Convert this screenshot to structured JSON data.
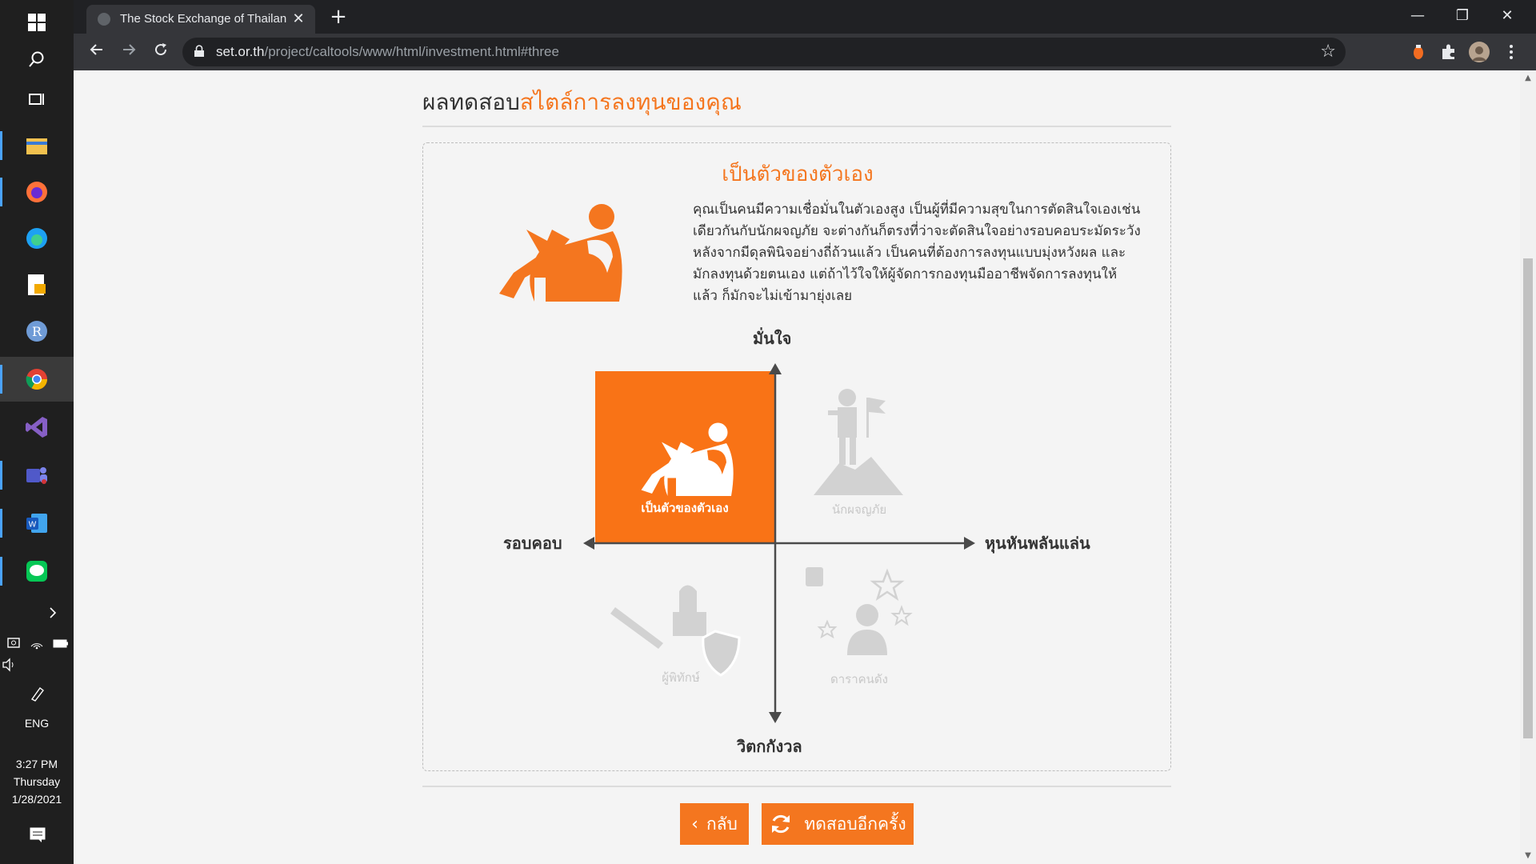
{
  "taskbar": {
    "time": "3:27 PM",
    "day": "Thursday",
    "date": "1/28/2021",
    "language": "ENG"
  },
  "browser": {
    "tab_title": "The Stock Exchange of Thailand :",
    "url_host": "set.or.th",
    "url_path": "/project/caltools/www/html/investment.html#three"
  },
  "page": {
    "heading_prefix": "ผลทดสอบ",
    "heading_accent": "สไตล์การลงทุนของคุณ",
    "result_title": "เป็นตัวของตัวเอง",
    "result_description": "คุณเป็นคนมีความเชื่อมั่นในตัวเองสูง เป็นผู้ที่มีความสุขในการตัดสินใจเองเช่นเดียวกันกับนักผจญภัย จะต่างกันก็ตรงที่ว่าจะตัดสินใจอย่างรอบคอบระมัดระวัง หลังจากมีดุลพินิจอย่างถี่ถ้วนแล้ว เป็นคนที่ต้องการลงทุนแบบมุ่งหวังผล และมักลงทุนด้วยตนเอง แต่ถ้าไว้ใจให้ผู้จัดการกองทุนมืออาชีพจัดการลงทุนให้แล้ว ก็มักจะไม่เข้ามายุ่งเลย",
    "axes": {
      "top": "มั่นใจ",
      "bottom": "วิตกกังวล",
      "left": "รอบคอบ",
      "right": "หุนหันพลันแล่น"
    },
    "quadrants": {
      "top_left": "เป็นตัวของตัวเอง",
      "top_right": "นักผจญภัย",
      "bottom_left": "ผู้พิทักษ์",
      "bottom_right": "ดาราคนดัง"
    },
    "buttons": {
      "back": "กลับ",
      "retry": "ทดสอบอีกครั้ง"
    }
  },
  "colors": {
    "accent": "#f4761f",
    "muted_icon": "#cfcfcf"
  }
}
